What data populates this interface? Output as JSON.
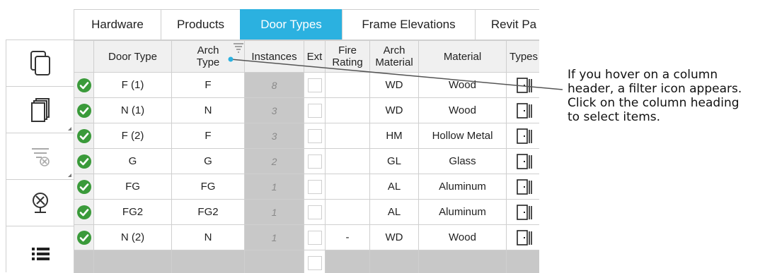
{
  "tabs": [
    "Hardware",
    "Products",
    "Door Types",
    "Frame Elevations",
    "Revit Pa"
  ],
  "active_tab": "Door Types",
  "columns": {
    "door_type": "Door Type",
    "arch_type_1": "Arch",
    "arch_type_2": "Type",
    "instances": "Instances",
    "ext": "Ext",
    "fire_1": "Fire",
    "fire_2": "Rating",
    "arch_mat_1": "Arch",
    "arch_mat_2": "Material",
    "material": "Material",
    "types": "Types"
  },
  "rows": [
    {
      "door_type": "F (1)",
      "arch_type": "F",
      "instances": "8",
      "fire_rating": "",
      "arch_material": "WD",
      "material": "Wood"
    },
    {
      "door_type": "N (1)",
      "arch_type": "N",
      "instances": "3",
      "fire_rating": "",
      "arch_material": "WD",
      "material": "Wood"
    },
    {
      "door_type": "F (2)",
      "arch_type": "F",
      "instances": "3",
      "fire_rating": "",
      "arch_material": "HM",
      "material": "Hollow Metal"
    },
    {
      "door_type": "G",
      "arch_type": "G",
      "instances": "2",
      "fire_rating": "",
      "arch_material": "GL",
      "material": "Glass"
    },
    {
      "door_type": "FG",
      "arch_type": "FG",
      "instances": "1",
      "fire_rating": "",
      "arch_material": "AL",
      "material": "Aluminum"
    },
    {
      "door_type": "FG2",
      "arch_type": "FG2",
      "instances": "1",
      "fire_rating": "",
      "arch_material": "AL",
      "material": "Aluminum"
    },
    {
      "door_type": "N (2)",
      "arch_type": "N",
      "instances": "1",
      "fire_rating": "-",
      "arch_material": "WD",
      "material": "Wood"
    }
  ],
  "callout": {
    "line1": "If you hover on a column",
    "line2": "header, a filter icon appears.",
    "line3": "Click on the column heading",
    "line4": "to select items."
  },
  "colors": {
    "accent": "#2bb1e0",
    "check": "#3a9a3a",
    "instances_bg": "#c8c8c8"
  }
}
